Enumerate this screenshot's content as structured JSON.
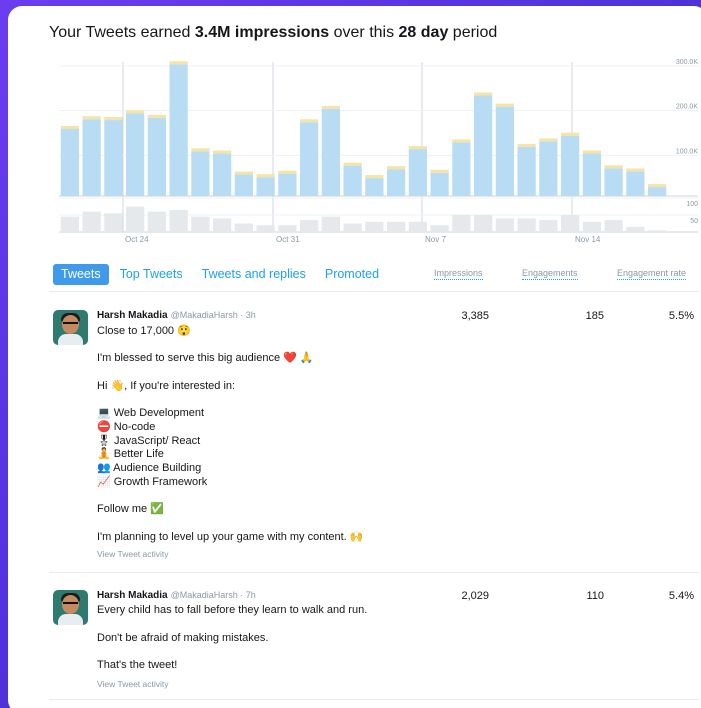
{
  "headline": {
    "prefix": "Your Tweets earned ",
    "impressions": "3.4M impressions",
    "middle": " over this ",
    "period": "28 day",
    "suffix": " period"
  },
  "chart_data": {
    "type": "bar",
    "title": "",
    "impressions": {
      "values": [
        150,
        172,
        170,
        185,
        175,
        295,
        100,
        95,
        48,
        42,
        50,
        165,
        195,
        68,
        40,
        60,
        105,
        52,
        120,
        225,
        200,
        110,
        122,
        135,
        95,
        62,
        55,
        20
      ],
      "ylim": [
        0,
        300
      ],
      "y_ticks": [
        "300.0K",
        "200.0K",
        "100.0K"
      ],
      "bar_color": "#b9dcf5",
      "cap_color": "#f6e3a6"
    },
    "engagements": {
      "values": [
        45,
        60,
        55,
        75,
        60,
        65,
        45,
        40,
        25,
        20,
        20,
        35,
        45,
        25,
        30,
        30,
        30,
        20,
        50,
        50,
        40,
        40,
        35,
        50,
        30,
        35,
        15,
        5
      ],
      "ylim": [
        0,
        100
      ],
      "y_ticks": [
        "100",
        "50"
      ],
      "bar_color": "#e6e9ec"
    },
    "x_ticks": [
      "Oct 24",
      "Oct 31",
      "Nov 7",
      "Nov 14"
    ]
  },
  "tabs": [
    "Tweets",
    "Top Tweets",
    "Tweets and replies",
    "Promoted"
  ],
  "columns": [
    "Impressions",
    "Engagements",
    "Engagement rate"
  ],
  "tweets": [
    {
      "name": "Harsh Makadia",
      "handle": "@MakadiaHarsh · 3h",
      "impressions": "3,385",
      "engagements": "185",
      "rate": "5.5%",
      "lines": [
        "Close to 17,000 😲",
        "I'm blessed to serve this big audience ❤️ 🙏",
        "Hi 👋, If you're interested in:",
        "💻 Web Development",
        "⛔ No-code",
        "🎖 JavaScript/ React",
        "🧘 Better Life",
        "👥 Audience Building",
        "📈 Growth Framework",
        "Follow me ✅",
        "I'm planning to level up your game with my content. 🙌"
      ],
      "activity": "View Tweet activity"
    },
    {
      "name": "Harsh Makadia",
      "handle": "@MakadiaHarsh · 7h",
      "impressions": "2,029",
      "engagements": "110",
      "rate": "5.4%",
      "lines": [
        "Every child has to fall before they learn to walk and run.",
        "Don't be afraid of making mistakes.",
        "That's the tweet!"
      ],
      "activity": "View Tweet activity"
    }
  ]
}
